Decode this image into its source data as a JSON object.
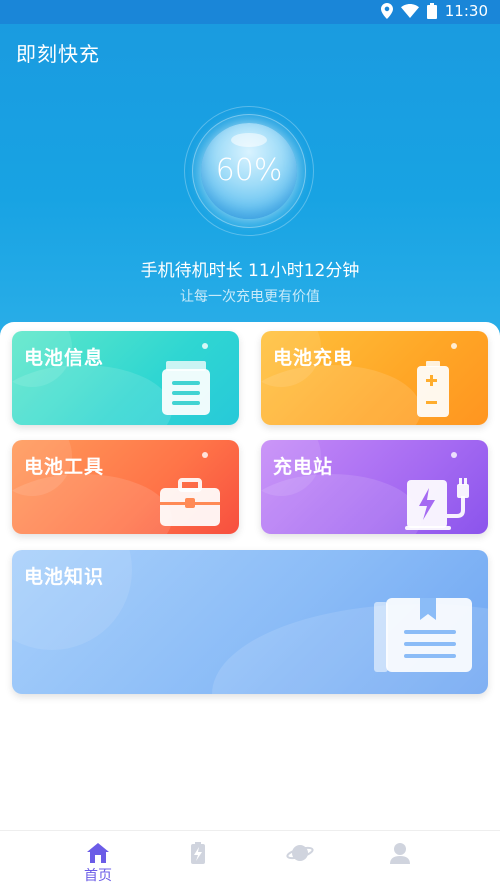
{
  "status_bar": {
    "time": "11:30"
  },
  "app": {
    "title": "即刻快充"
  },
  "battery": {
    "percent_label": "60%",
    "standby_text": "手机待机时长 11小时12分钟",
    "slogan": "让每一次充电更有价值"
  },
  "cards": {
    "info": {
      "label": "电池信息",
      "icon": "battery-info-icon"
    },
    "charge": {
      "label": "电池充电",
      "icon": "battery-charge-icon"
    },
    "tools": {
      "label": "电池工具",
      "icon": "toolbox-icon"
    },
    "station": {
      "label": "充电站",
      "icon": "charging-station-icon"
    },
    "knowledge": {
      "label": "电池知识",
      "icon": "book-icon"
    }
  },
  "tab_bar": {
    "items": [
      {
        "label": "首页",
        "icon": "home-icon",
        "active": true
      },
      {
        "label": "",
        "icon": "battery-icon",
        "active": false
      },
      {
        "label": "",
        "icon": "planet-icon",
        "active": false
      },
      {
        "label": "",
        "icon": "user-icon",
        "active": false
      }
    ]
  },
  "colors": {
    "header": "#18a3e3",
    "active_tab": "#6b5ce7",
    "inactive_tab": "#d0d4de"
  }
}
